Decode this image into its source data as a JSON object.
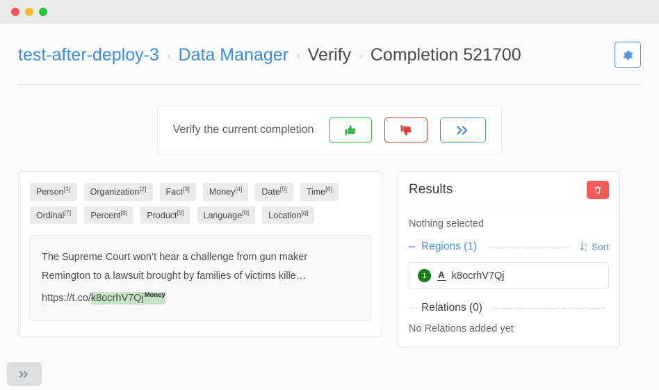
{
  "window": {
    "traffic_lights": [
      "close",
      "minimize",
      "zoom"
    ]
  },
  "header": {
    "breadcrumb": [
      {
        "label": "test-after-deploy-3",
        "type": "link"
      },
      {
        "label": "Data Manager",
        "type": "link"
      },
      {
        "label": "Verify",
        "type": "text"
      },
      {
        "label": "Completion 521700",
        "type": "text"
      }
    ],
    "separator": "›",
    "settings_icon": "gear-icon"
  },
  "verify": {
    "prompt": "Verify the current completion",
    "accept_icon": "thumbs-up-icon",
    "reject_icon": "thumbs-down-icon",
    "skip_icon": "double-chevron-right-icon"
  },
  "labels": [
    {
      "name": "Person",
      "hotkey": "[1]"
    },
    {
      "name": "Organization",
      "hotkey": "[2]"
    },
    {
      "name": "Fact",
      "hotkey": "[3]"
    },
    {
      "name": "Money",
      "hotkey": "[4]"
    },
    {
      "name": "Date",
      "hotkey": "[5]"
    },
    {
      "name": "Time",
      "hotkey": "[6]"
    },
    {
      "name": "Ordinal",
      "hotkey": "[7]"
    },
    {
      "name": "Percent",
      "hotkey": "[8]"
    },
    {
      "name": "Product",
      "hotkey": "[9]"
    },
    {
      "name": "Language",
      "hotkey": "[0]"
    },
    {
      "name": "Location",
      "hotkey": "[q]"
    }
  ],
  "text_content": {
    "before": "The Supreme Court won’t hear a challenge from gun maker Remington to a lawsuit brought by families of victims kille… https://t.co/",
    "highlight": "k8ocrhV7Qj",
    "highlight_label": "Money",
    "highlight_color": "#c6e3c3"
  },
  "results": {
    "title": "Results",
    "delete_icon": "trash-icon",
    "nothing_selected": "Nothing selected",
    "regions": {
      "title": "Regions (1)",
      "sort_label": "Sort",
      "sort_icon": "sort-az-icon",
      "items": [
        {
          "index": "1",
          "type_icon": "text-label-icon",
          "text": "k8ocrhV7Qj"
        }
      ]
    },
    "relations": {
      "title": "Relations (0)",
      "empty_text": "No Relations added yet"
    }
  },
  "footer": {
    "expand_icon": "double-chevron-right-icon"
  },
  "colors": {
    "accent_blue": "#4a90d9",
    "accept_green": "#3bb54a",
    "reject_red": "#e03b3b",
    "delete_red": "#f35b57",
    "badge_green": "#167d1b"
  }
}
